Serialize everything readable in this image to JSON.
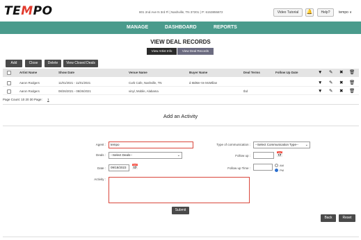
{
  "brand": {
    "logo_pre": "TE",
    "logo_mid": "M",
    "logo_post": "PO"
  },
  "header": {
    "address": "801 2nd Ave N 3rd Fl | Nashville, TN 37201 | P: 6153855872",
    "video_tutorial": "Video Tutorial",
    "bell_icon": "bell-icon",
    "help": "Help?",
    "user": "tempo ∨"
  },
  "nav": {
    "items": [
      "MANAGE",
      "DASHBOARD",
      "REPORTS"
    ]
  },
  "page": {
    "title": "VIEW DEAL RECORDS",
    "sub_buttons": {
      "artist_info": "View Artist Info",
      "deal_records": "View Deal Records"
    }
  },
  "actions": {
    "add": "Add",
    "close": "Close",
    "delete": "Delete",
    "view_closed": "View Closed Deals"
  },
  "table": {
    "columns": {
      "artist": "Artist Name",
      "show_date": "Show Date",
      "venue": "Venue Name",
      "buyer": "Buyer Name",
      "terms": "Deal Terms",
      "followup": "Follow Up Date"
    },
    "rows": [
      {
        "artist": "Aaron Rodgers",
        "show_date": "11/01/2021 - 11/01/2021",
        "venue": "Curb Cafe, Nashville, TN",
        "buyer": "á MdMe-Ve McMillan",
        "terms": "",
        "followup": ""
      },
      {
        "artist": "Aaron Rodgers",
        "show_date": "08/26/2021 - 08/26/2021",
        "venue": "vinyl, Mobile, Alabama",
        "buyer": "",
        "terms": "tbd",
        "followup": ""
      }
    ],
    "page_count": "Page Count: 10  20  30  Page:",
    "page_num": "1"
  },
  "activity": {
    "title": "Add an Activity",
    "agent_label": "Agent :",
    "agent_value": "tempo",
    "deals_label": "Deals :",
    "deals_value": "--Select Deals--",
    "date_label": "Date :",
    "date_value": "09/18/2023",
    "activity_label": "Activity :",
    "comm_label": "Type of communication :",
    "comm_value": "--Select Communication Type--",
    "followup_label": "Follow up :",
    "followup_time_label": "Follow up Time :",
    "am": "AM",
    "pm": "PM",
    "submit": "Submit",
    "back": "Back",
    "reset": "Reset"
  },
  "colors": {
    "nav": "#4a9b8c",
    "accent_red": "#e23b2e",
    "active_sub": "#6b6b80",
    "dark_btn": "#4a4a4a"
  }
}
